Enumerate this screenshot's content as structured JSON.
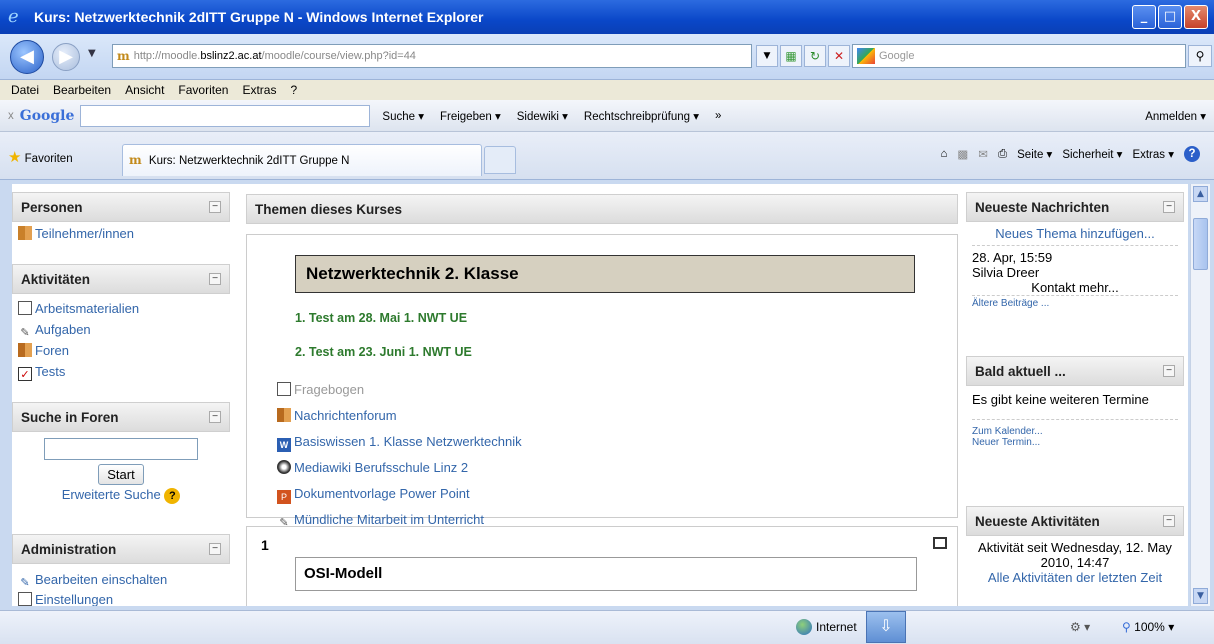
{
  "window": {
    "title": "Kurs: Netzwerktechnik 2dITT Gruppe N - Windows Internet Explorer",
    "btn_min": "_",
    "btn_max": "□",
    "btn_close": "X"
  },
  "address": {
    "url_prefix": "http://moodle.",
    "url_host": "bslinz2.ac.at",
    "url_suffix": "/moodle/course/view.php?id=44",
    "search_placeholder": "Google"
  },
  "menu": [
    "Datei",
    "Bearbeiten",
    "Ansicht",
    "Favoriten",
    "Extras",
    "?"
  ],
  "google_toolbar": {
    "close": "x",
    "logo": "Google",
    "items": [
      "Suche ▾",
      "Freigeben ▾",
      "Sidewiki ▾",
      "Rechtschreibprüfung ▾",
      "»"
    ],
    "signin": "Anmelden ▾"
  },
  "favorites": {
    "label": "Favoriten",
    "tab_title": "Kurs: Netzwerktechnik 2dITT Gruppe N",
    "commands": [
      "Seite ▾",
      "Sicherheit ▾",
      "Extras ▾"
    ]
  },
  "left": {
    "personen": {
      "title": "Personen",
      "items": [
        "Teilnehmer/innen"
      ]
    },
    "aktivitaeten": {
      "title": "Aktivitäten",
      "items": [
        "Arbeitsmaterialien",
        "Aufgaben",
        "Foren",
        "Tests"
      ]
    },
    "suche": {
      "title": "Suche in Foren",
      "button": "Start",
      "advanced": "Erweiterte Suche"
    },
    "admin": {
      "title": "Administration",
      "items": [
        "Bearbeiten einschalten",
        "Einstellungen"
      ]
    }
  },
  "center": {
    "header": "Themen dieses Kurses",
    "section0_title": "Netzwerktechnik 2. Klasse",
    "tests": [
      "1. Test am 28. Mai 1. NWT UE",
      "2. Test am 23. Juni 1. NWT UE"
    ],
    "resources": [
      "Fragebogen",
      "Nachrichtenforum",
      "Basiswissen 1. Klasse Netzwerktechnik",
      "Mediawiki Berufsschule Linz 2",
      "Dokumentvorlage Power Point",
      "Mündliche Mitarbeit im Unterricht"
    ],
    "section1_number": "1",
    "section1_title": "OSI-Modell"
  },
  "right": {
    "news": {
      "title": "Neueste Nachrichten",
      "add": "Neues Thema hinzufügen...",
      "date": "28. Apr, 15:59",
      "author": "Silvia Dreer",
      "contact": "Kontakt mehr...",
      "older": "Ältere Beiträge ..."
    },
    "upcoming": {
      "title": "Bald aktuell ...",
      "text": "Es gibt keine weiteren Termine",
      "calendar": "Zum Kalender...",
      "new_event": "Neuer Termin..."
    },
    "activity": {
      "title": "Neueste Aktivitäten",
      "since": "Aktivität seit Wednesday, 12. May 2010, 14:47",
      "all": "Alle Aktivitäten der letzten Zeit"
    }
  },
  "status": {
    "zone": "Internet",
    "zoom": "100%"
  }
}
